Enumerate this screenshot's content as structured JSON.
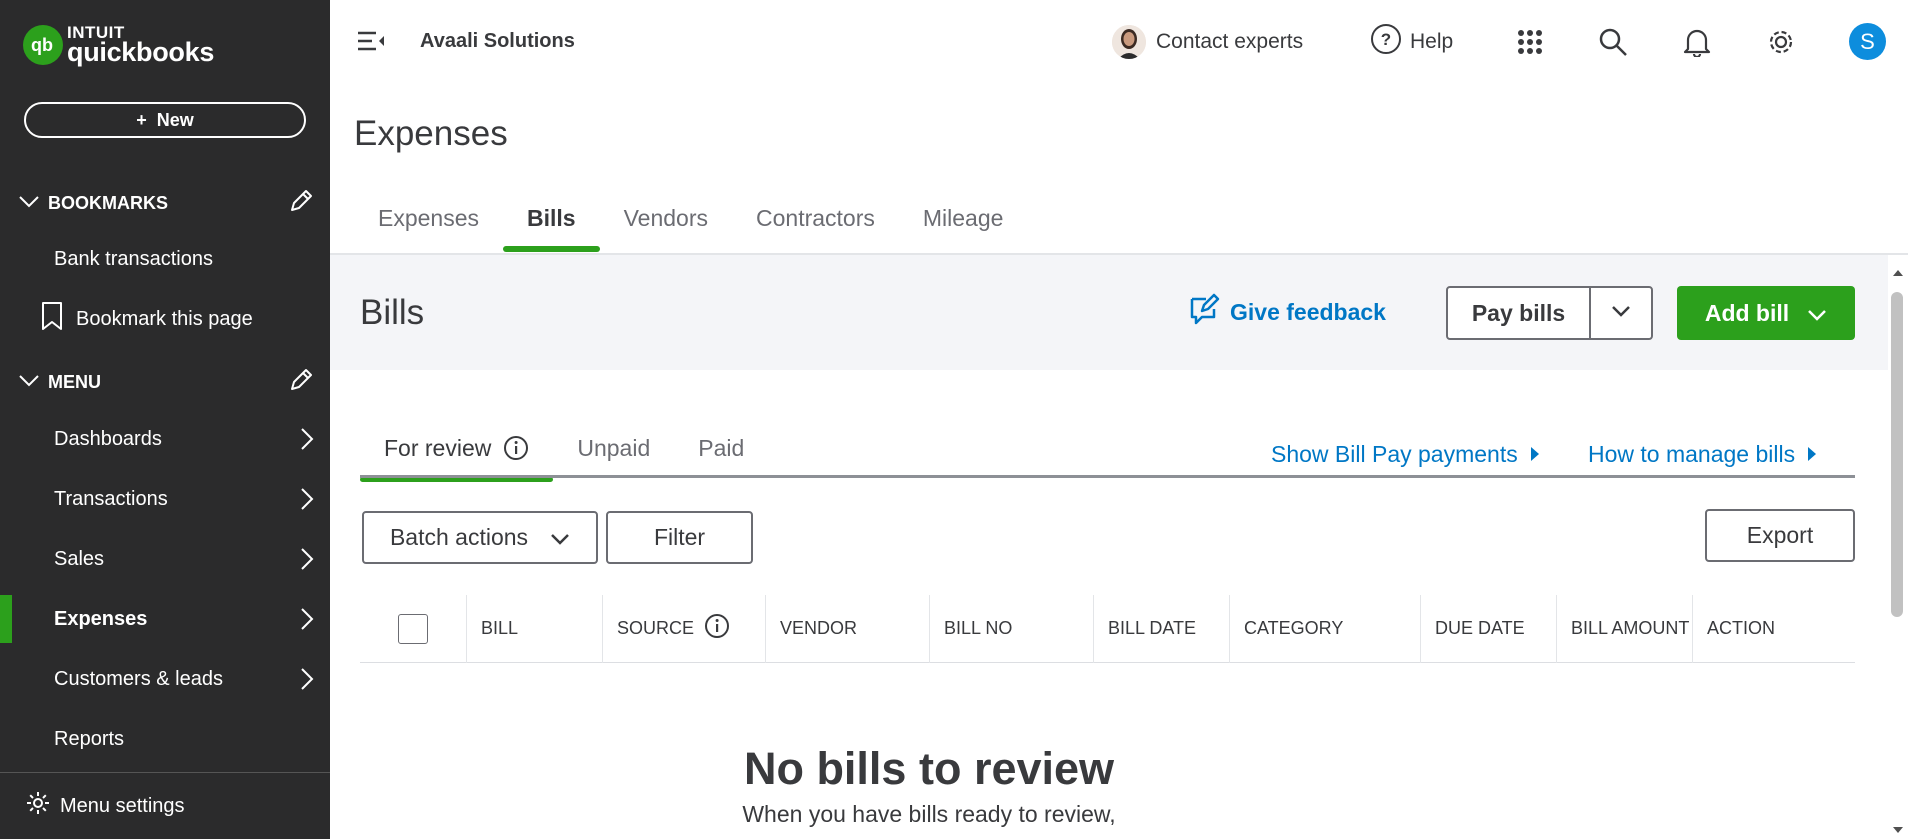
{
  "sidebar": {
    "logo_intuit": "INTUIT",
    "logo_qb": "quickbooks",
    "new_label": "New",
    "bookmarks_label": "BOOKMARKS",
    "bookmark_items": [
      {
        "label": "Bank transactions"
      },
      {
        "label": "Bookmark this page"
      }
    ],
    "menu_label": "MENU",
    "menu_items": [
      {
        "label": "Dashboards"
      },
      {
        "label": "Transactions"
      },
      {
        "label": "Sales"
      },
      {
        "label": "Expenses"
      },
      {
        "label": "Customers & leads"
      },
      {
        "label": "Reports"
      }
    ],
    "footer_label": "Menu settings"
  },
  "topbar": {
    "company": "Avaali Solutions",
    "contact_label": "Contact experts",
    "help_label": "Help",
    "user_initial": "S"
  },
  "page": {
    "title": "Expenses",
    "tabs": [
      {
        "label": "Expenses"
      },
      {
        "label": "Bills"
      },
      {
        "label": "Vendors"
      },
      {
        "label": "Contractors"
      },
      {
        "label": "Mileage"
      }
    ]
  },
  "bills": {
    "title": "Bills",
    "feedback_label": "Give feedback",
    "pay_bills_label": "Pay bills",
    "add_bill_label": "Add bill",
    "subtabs": [
      {
        "label": "For review"
      },
      {
        "label": "Unpaid"
      },
      {
        "label": "Paid"
      }
    ],
    "show_billpay_label": "Show Bill Pay payments",
    "how_to_label": "How to manage bills",
    "batch_actions_label": "Batch actions",
    "filter_label": "Filter",
    "export_label": "Export",
    "columns": [
      "BILL",
      "SOURCE",
      "VENDOR",
      "BILL NO",
      "BILL DATE",
      "CATEGORY",
      "DUE DATE",
      "BILL AMOUNT",
      "ACTION"
    ],
    "empty_title": "No bills to review",
    "empty_sub": "When you have bills ready to review,"
  },
  "colors": {
    "brand_green": "#2ca01c",
    "link_blue": "#0077c5",
    "sidebar_bg": "#2b2b2c"
  }
}
